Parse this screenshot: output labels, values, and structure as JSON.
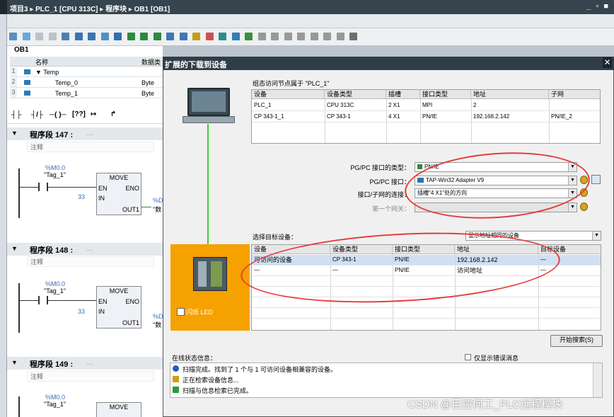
{
  "window": {
    "breadcrumb": "项目3 ▸ PLC_1 [CPU 313C] ▸ 程序块 ▸ OB1 [OB1]",
    "controls": "_ ▫ ■"
  },
  "editor": {
    "block_name": "OB1",
    "interface": {
      "headers": [
        "名称",
        "数据类"
      ],
      "rows": [
        {
          "num": "1",
          "name": "▼ Temp",
          "type": ""
        },
        {
          "num": "2",
          "name": "Temp_0",
          "type": "Byte"
        },
        {
          "num": "3",
          "name": "Temp_1",
          "type": "Byte"
        }
      ]
    },
    "segments": [
      {
        "title": "程序段 147 :",
        "dots": "....",
        "note": "注释",
        "addr": "%M0.0",
        "tag": "\"Tag_1\"",
        "move": "MOVE",
        "en": "EN",
        "eno": "ENO",
        "in_val": "33",
        "in": "IN",
        "out1": "OUT1",
        "out_addr": "%D",
        "out_tag": "\"数"
      },
      {
        "title": "程序段 148 :",
        "dots": "....",
        "note": "注释",
        "addr": "%M0.0",
        "tag": "\"Tag_1\"",
        "move": "MOVE",
        "en": "EN",
        "eno": "ENO",
        "in_val": "33",
        "in": "IN",
        "out1": "OUT1",
        "out_addr": "%D",
        "out_tag": "\"数"
      },
      {
        "title": "程序段 149 :",
        "dots": "....",
        "note": "注释",
        "addr": "%M0.0",
        "tag": "\"Tag_1\"",
        "move": "MOVE"
      }
    ]
  },
  "dialog": {
    "title": "扩展的下载到设备",
    "close": "✕",
    "config_caption": "组态访问节点属于 \"PLC_1\"",
    "config_headers": [
      "设备",
      "设备类型",
      "插槽",
      "接口类型",
      "地址",
      "子网"
    ],
    "config_rows": [
      [
        "PLC_1",
        "CPU 313C",
        "2 X1",
        "MPI",
        "2",
        ""
      ],
      [
        "CP 343-1_1",
        "CP 343-1",
        "4 X1",
        "PN/IE",
        "192.168.2.142",
        "PN/IE_2"
      ]
    ],
    "pgpc_type_label": "PG/PC 接口的类型：",
    "pgpc_type_value": "PN/IE",
    "pgpc_if_label": "PG/PC 接口：",
    "pgpc_if_value": "TAP-Win32 Adapter V9",
    "subnet_label": "接口/子网的连接：",
    "subnet_value": "插槽\"4 X1\"处的方向",
    "gateway_label": "第一个网关：",
    "gateway_value": "",
    "target_label": "选择目标设备：",
    "target_filter": "显示地址相同的设备",
    "target_headers": [
      "设备",
      "设备类型",
      "接口类型",
      "地址",
      "目标设备"
    ],
    "target_rows": [
      [
        "可访问的设备",
        "CP 343-1",
        "PN/IE",
        "192.168.2.142",
        "—"
      ],
      [
        "—",
        "—",
        "PN/IE",
        "访问地址",
        "—"
      ]
    ],
    "flash_led": "闪烁 LED",
    "start_search": "开始搜索(S)",
    "status_label": "在线状态信息：",
    "errors_only": "仅显示错误消息",
    "messages": [
      {
        "icon": "info-icon",
        "text": "扫描完成。找到了 1 个与 1 可访问设备相兼容的设备。"
      },
      {
        "icon": "search-progress-icon",
        "text": "正在检索设备信息..."
      },
      {
        "icon": "check-icon",
        "text": "扫描与信息检索已完成。"
      }
    ]
  },
  "watermark": "CSDN @巨控何工_PLC远程模块",
  "colors": {
    "accent_orange": "#f5a100",
    "link_green": "#3dcc3d",
    "annotation_red": "#e63b3b",
    "title_dark": "#35444e"
  }
}
